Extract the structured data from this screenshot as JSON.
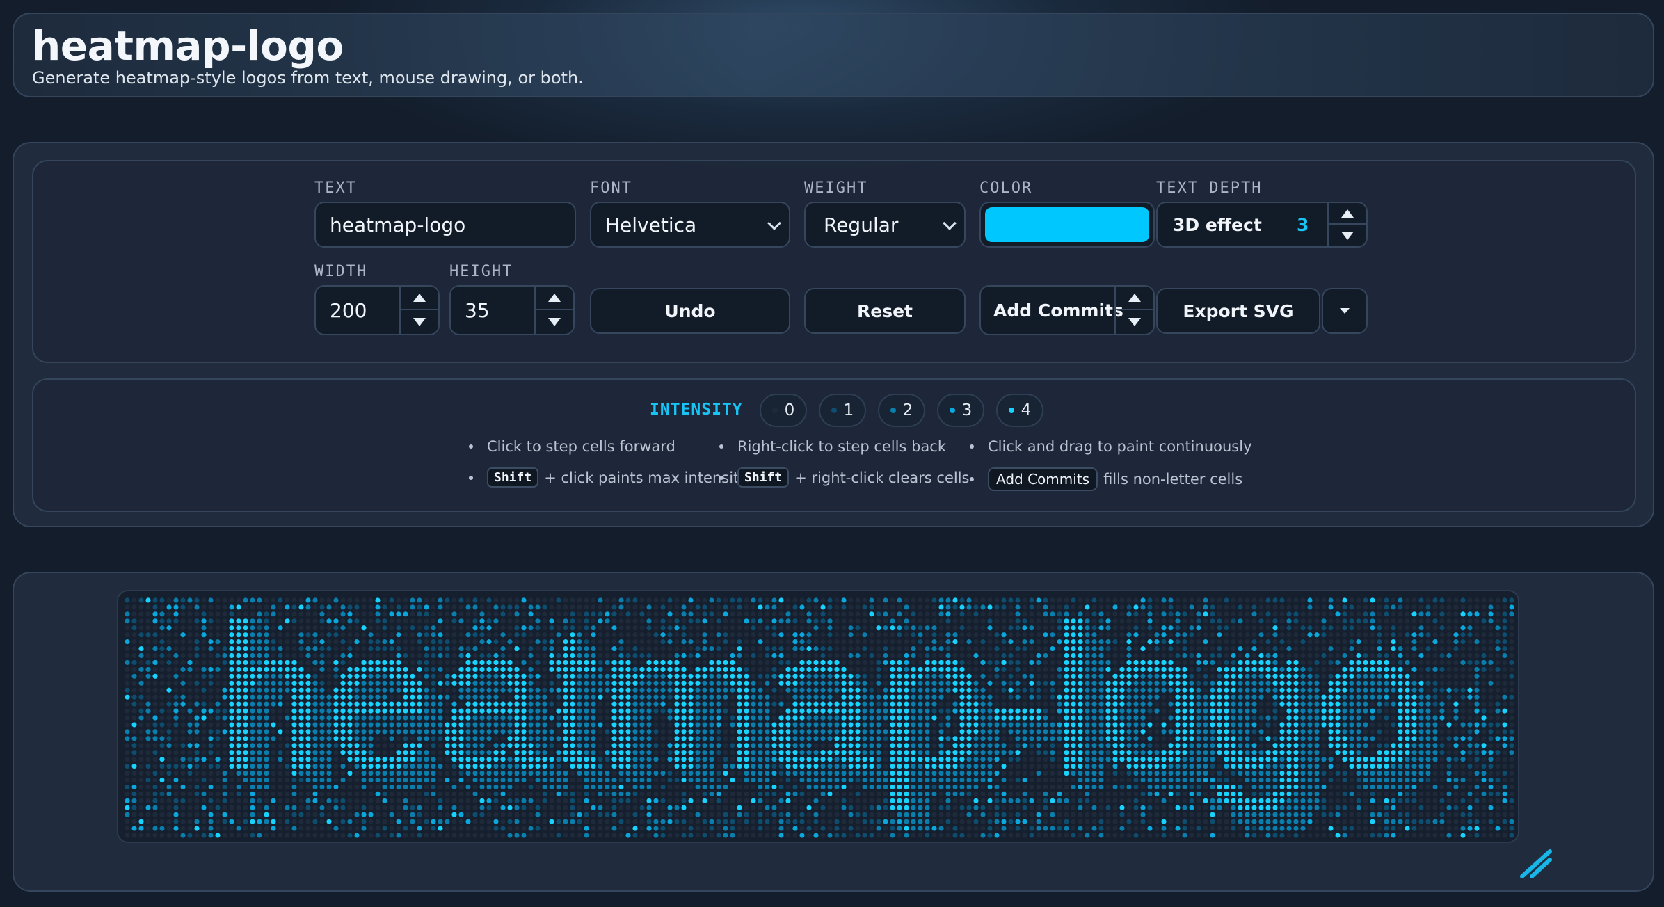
{
  "header": {
    "title": "heatmap-logo",
    "subtitle": "Generate heatmap-style logos from text, mouse drawing, or both."
  },
  "form": {
    "text_label": "TEXT",
    "text_value": "heatmap-logo",
    "font_label": "FONT",
    "font_value": "Helvetica",
    "weight_label": "WEIGHT",
    "weight_value": "Regular",
    "color_label": "COLOR",
    "color_value": "#00c8ff",
    "depth_label": "TEXT DEPTH",
    "depth_text": "3D effect",
    "depth_value": "3",
    "width_label": "WIDTH",
    "width_value": "200",
    "height_label": "HEIGHT",
    "height_value": "35",
    "undo_label": "Undo",
    "reset_label": "Reset",
    "add_commits_label": "Add Commits",
    "export_label": "Export SVG"
  },
  "legend": {
    "intensity_label": "INTENSITY",
    "levels": [
      "0",
      "1",
      "2",
      "3",
      "4"
    ],
    "level_colors": [
      "#1e2a3a",
      "#0e4d6e",
      "#0a7fae",
      "#0aa8dc",
      "#18d2ff"
    ],
    "hints": {
      "h1": "Click to step cells forward",
      "h2": "Right-click to step cells back",
      "h3": "Click and drag to paint continuously",
      "h4_key": "Shift",
      "h4": "+ click paints max intensity",
      "h5_key": "Shift",
      "h5": "+ right-click clears cells",
      "h6_key": "Add Commits",
      "h6": "fills non-letter cells"
    }
  },
  "canvas": {
    "grid_text": "heatmap-logo",
    "columns": 200,
    "rows": 35
  },
  "icons": {
    "resize": "resize-handle-icon",
    "dropdown": "chevron-down-icon",
    "spinner_up": "arrow-up-icon",
    "spinner_down": "arrow-down-icon"
  }
}
